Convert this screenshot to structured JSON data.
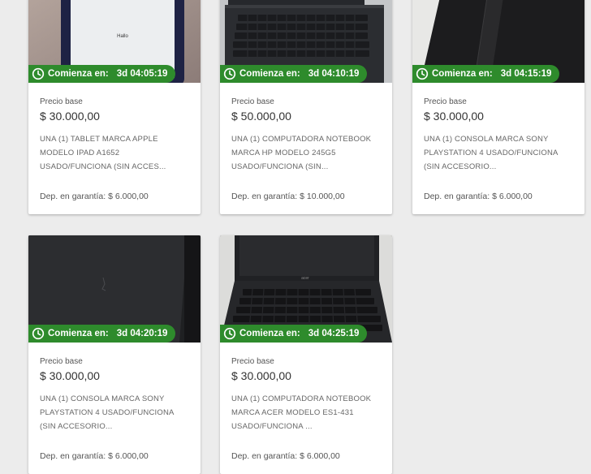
{
  "colors": {
    "timer_bg": "#2e8b2c",
    "page_bg": "#ececec"
  },
  "icons": {
    "timer": "clock-icon"
  },
  "listings": [
    {
      "timer_label": "Comienza en:",
      "timer_value": "3d 04:05:19",
      "price_label": "Precio base",
      "price": "$ 30.000,00",
      "description": "UNA (1) TABLET MARCA APPLE MODELO IPAD A1652 USADO/FUNCIONA (SIN ACCES...",
      "deposit_label": "Dep. en garantía:",
      "deposit_value": "$ 6.000,00",
      "image_text": "Hallo"
    },
    {
      "timer_label": "Comienza en:",
      "timer_value": "3d 04:10:19",
      "price_label": "Precio base",
      "price": "$ 50.000,00",
      "description": "UNA (1) COMPUTADORA NOTEBOOK MARCA HP MODELO 245G5 USADO/FUNCIONA (SIN...",
      "deposit_label": "Dep. en garantía:",
      "deposit_value": "$ 10.000,00"
    },
    {
      "timer_label": "Comienza en:",
      "timer_value": "3d 04:15:19",
      "price_label": "Precio base",
      "price": "$ 30.000,00",
      "description": "UNA (1) CONSOLA MARCA SONY PLAYSTATION 4 USADO/FUNCIONA (SIN ACCESORIO...",
      "deposit_label": "Dep. en garantía:",
      "deposit_value": "$ 6.000,00"
    },
    {
      "timer_label": "Comienza en:",
      "timer_value": "3d 04:20:19",
      "price_label": "Precio base",
      "price": "$ 30.000,00",
      "description": "UNA (1) CONSOLA MARCA SONY PLAYSTATION 4 USADO/FUNCIONA (SIN ACCESORIO...",
      "deposit_label": "Dep. en garantía:",
      "deposit_value": "$ 6.000,00"
    },
    {
      "timer_label": "Comienza en:",
      "timer_value": "3d 04:25:19",
      "price_label": "Precio base",
      "price": "$ 30.000,00",
      "description": "UNA (1) COMPUTADORA NOTEBOOK MARCA ACER MODELO ES1-431 USADO/FUNCIONA ...",
      "deposit_label": "Dep. en garantía:",
      "deposit_value": "$ 6.000,00",
      "image_text": "acer"
    }
  ]
}
